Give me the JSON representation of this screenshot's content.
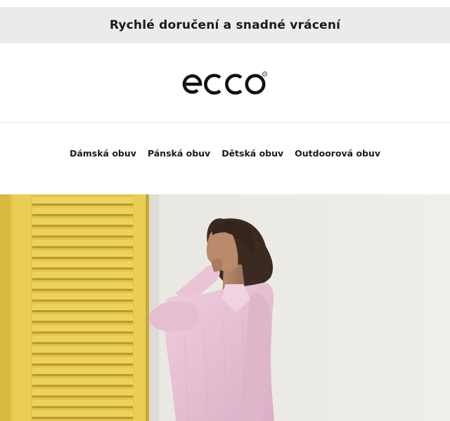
{
  "banner": {
    "text": "Rychlé doručení a snadné vrácení"
  },
  "logo": {
    "text": "ecco"
  },
  "nav": {
    "items": [
      {
        "label": "Dámská obuv"
      },
      {
        "label": "Pánská obuv"
      },
      {
        "label": "Dětská obuv"
      },
      {
        "label": "Outdoorová obuv"
      }
    ]
  },
  "hero": {
    "image": "model-pink-shirt-yellow-shutter"
  },
  "colors": {
    "banner_bg": "#ebebeb",
    "shutter_yellow": "#e8cc4e",
    "wall": "#ecebe7",
    "shirt_pink": "#e8c3d6"
  }
}
